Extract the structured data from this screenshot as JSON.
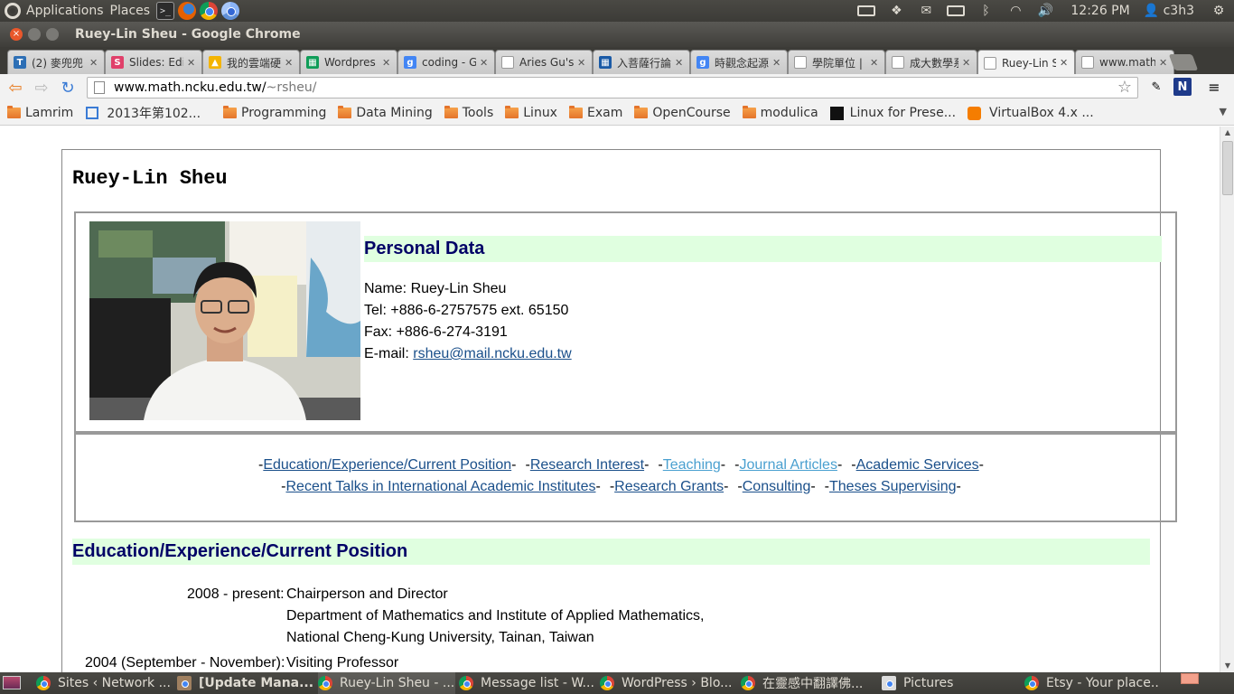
{
  "panel": {
    "menus": [
      "Applications",
      "Places"
    ],
    "clock": "12:26 PM",
    "user": "c3h3"
  },
  "window": {
    "title": "Ruey-Lin Sheu - Google Chrome"
  },
  "tabs": [
    {
      "label": "(2) 麥兜兜",
      "fav_color": "#2d6fb5",
      "fav_char": "T"
    },
    {
      "label": "Slides: Edi",
      "fav_color": "#e0406a",
      "fav_char": "S"
    },
    {
      "label": "我的雲端硬",
      "fav_color": "#f4b400",
      "fav_char": "▲"
    },
    {
      "label": "Wordpres",
      "fav_color": "#0f9d58",
      "fav_char": "▦"
    },
    {
      "label": "coding - G",
      "fav_color": "#4285f4",
      "fav_char": "g"
    },
    {
      "label": "Aries Gu's",
      "fav_color": "#ffffff",
      "fav_char": ""
    },
    {
      "label": "入菩薩行論",
      "fav_color": "#1a5aa6",
      "fav_char": "▦"
    },
    {
      "label": "時觀念起源",
      "fav_color": "#4285f4",
      "fav_char": "g"
    },
    {
      "label": "學院單位 |",
      "fav_color": "#ffffff",
      "fav_char": ""
    },
    {
      "label": "成大數學系",
      "fav_color": "#ffffff",
      "fav_char": ""
    },
    {
      "label": "Ruey-Lin S",
      "fav_color": "#ffffff",
      "fav_char": ""
    },
    {
      "label": "www.math",
      "fav_color": "#ffffff",
      "fav_char": ""
    }
  ],
  "omnibox": {
    "host": "www.math.ncku.edu.tw/",
    "path": "~rsheu/"
  },
  "toolbar_ext": {
    "n_label": "N"
  },
  "bookmarks": [
    {
      "label": "Lamrim",
      "icon": "folder"
    },
    {
      "label": "2013年第102...",
      "icon": "page"
    },
    {
      "label": "Programming",
      "icon": "folder"
    },
    {
      "label": "Data Mining",
      "icon": "folder"
    },
    {
      "label": "Tools",
      "icon": "folder"
    },
    {
      "label": "Linux",
      "icon": "folder"
    },
    {
      "label": "Exam",
      "icon": "folder"
    },
    {
      "label": "OpenCourse",
      "icon": "folder"
    },
    {
      "label": "modulica",
      "icon": "folder"
    },
    {
      "label": "Linux for Prese...",
      "icon": "dark"
    },
    {
      "label": "VirtualBox 4.x ...",
      "icon": "blogger"
    }
  ],
  "page": {
    "name": "Ruey-Lin Sheu",
    "personal_heading": "Personal Data",
    "name_line": "Name: Ruey-Lin Sheu",
    "tel_line": "Tel: +886-6-2757575 ext. 65150",
    "fax_line": "Fax: +886-6-274-3191",
    "email_prefix": "E-mail: ",
    "email": "rsheu@mail.ncku.edu.tw",
    "nav_row1": [
      {
        "label": "Education/Experience/Current Position",
        "visited": false
      },
      {
        "label": "Research Interest",
        "visited": false
      },
      {
        "label": "Teaching",
        "visited": true
      },
      {
        "label": "Journal Articles",
        "visited": true
      },
      {
        "label": "Academic Services",
        "visited": false
      }
    ],
    "nav_row2": [
      {
        "label": "Recent Talks in International Academic Institutes",
        "visited": false
      },
      {
        "label": "Research Grants",
        "visited": false
      },
      {
        "label": "Consulting",
        "visited": false
      },
      {
        "label": "Theses Supervising",
        "visited": false
      }
    ],
    "edu_heading": "Education/Experience/Current Position",
    "edu": [
      {
        "period": "2008 - present:",
        "lines": [
          "Chairperson and Director",
          "Department of Mathematics and Institute of Applied Mathematics,",
          "National Cheng-Kung University, Tainan, Taiwan"
        ]
      },
      {
        "period": "2004 (September - November):",
        "lines": [
          "Visiting Professor"
        ]
      }
    ]
  },
  "taskbar": [
    {
      "label": "Sites ‹ Network ...",
      "active": false
    },
    {
      "label": "[Update Mana...",
      "active": false
    },
    {
      "label": "Ruey-Lin Sheu - ...",
      "active": true
    },
    {
      "label": "Message list - W...",
      "active": false
    },
    {
      "label": "WordPress › Blo...",
      "active": false
    },
    {
      "label": "在靈感中翻譯佛...",
      "active": false
    },
    {
      "label": "Pictures",
      "active": false
    },
    {
      "label": "Etsy - Your place...",
      "active": false
    }
  ]
}
